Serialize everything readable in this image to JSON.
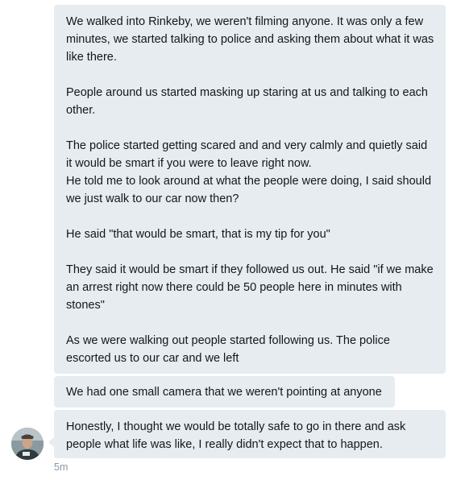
{
  "messages": [
    {
      "paragraphs": [
        "We walked into Rinkeby, we weren't filming anyone. It was only a few minutes, we started talking to police and asking them about what it was like there.",
        "People around us started masking up staring at us and talking to each other.",
        "The police started getting scared and and very calmly and quietly said it would be smart if you were to leave right now.\nHe told me to look around at what the people were doing, I said should we just walk to our car now then?",
        "He said \"that would be smart, that is my tip for you\"",
        "They said it would be smart if they followed us out. He said \"if we make an arrest right now there could be 50 people here in minutes with stones\"",
        "As we were walking out people started following us. The police escorted us to our car and we left"
      ]
    },
    {
      "text": "We had one small camera that we weren't pointing at anyone"
    },
    {
      "text": "Honestly, I thought we would be totally safe to go in there and ask people what life was like, I really didn't expect that to happen."
    }
  ],
  "timestamp": "5m",
  "colors": {
    "bubble_bg": "#e6ecf0",
    "text": "#14171a",
    "timestamp": "#8899a6"
  },
  "icons": {
    "avatar": "user-avatar-photo"
  }
}
